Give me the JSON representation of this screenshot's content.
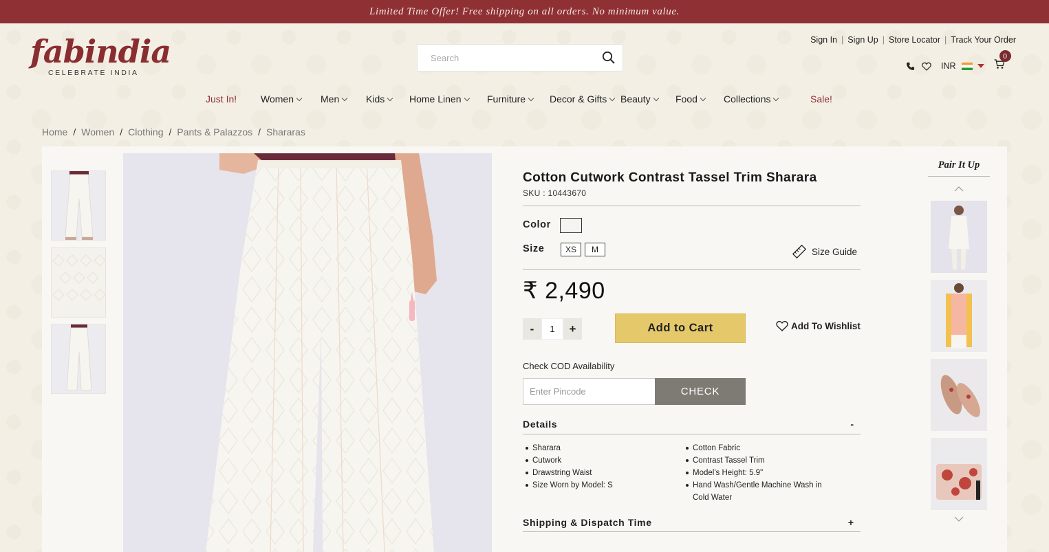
{
  "promo": {
    "text": "Limited Time Offer! Free shipping on all orders. No minimum value."
  },
  "logo": {
    "word": "fabindia",
    "tagline": "CELEBRATE INDIA"
  },
  "search": {
    "placeholder": "Search"
  },
  "top_links": [
    "Sign In",
    "Sign Up",
    "Store Locator",
    "Track Your Order"
  ],
  "utility": {
    "currency": "INR",
    "cart_count": "0"
  },
  "nav": [
    {
      "label": "Just In!",
      "dropdown": false,
      "highlight": true
    },
    {
      "label": "Women",
      "dropdown": true
    },
    {
      "label": "Men",
      "dropdown": true
    },
    {
      "label": "Kids",
      "dropdown": true
    },
    {
      "label": "Home Linen",
      "dropdown": true
    },
    {
      "label": "Furniture",
      "dropdown": true
    },
    {
      "label": "Decor & Gifts",
      "dropdown": true
    },
    {
      "label": "Beauty",
      "dropdown": true
    },
    {
      "label": "Food",
      "dropdown": true
    },
    {
      "label": "Collections",
      "dropdown": true
    },
    {
      "label": "Sale!",
      "dropdown": false,
      "highlight": true
    }
  ],
  "breadcrumb": [
    "Home",
    "Women",
    "Clothing",
    "Pants & Palazzos",
    "Shararas"
  ],
  "product": {
    "title": "Cotton Cutwork Contrast Tassel Trim Sharara",
    "sku": "SKU : 10443670",
    "color_label": "Color",
    "size_label": "Size",
    "sizes": [
      "XS",
      "M"
    ],
    "size_guide": "Size Guide",
    "price": "₹ 2,490",
    "qty_minus": "-",
    "qty": "1",
    "qty_plus": "+",
    "add_to_cart": "Add to Cart",
    "wishlist": "Add To Wishlist",
    "cod_label": "Check COD Availability",
    "pincode_placeholder": "Enter Pincode",
    "check": "CHECK",
    "details_title": "Details",
    "details_toggle": "-",
    "details_left": [
      "Sharara",
      "Cutwork",
      "Drawstring Waist",
      "Size Worn by Model: S"
    ],
    "details_right": [
      "Cotton Fabric",
      "Contrast Tassel Trim",
      "Model's Height: 5.9\"",
      "Hand Wash/Gentle Machine Wash in Cold Water"
    ],
    "shipping_title": "Shipping & Dispatch Time",
    "shipping_toggle": "+"
  },
  "pair": {
    "title": "Pair It Up"
  },
  "colors": {
    "brand": "#8f3034",
    "cta": "#e5c86a",
    "check": "#7e7a74"
  }
}
